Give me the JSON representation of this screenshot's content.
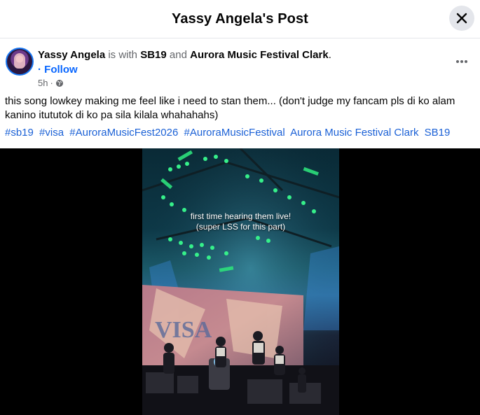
{
  "dialog": {
    "title": "Yassy Angela's Post"
  },
  "post": {
    "author": "Yassy Angela",
    "with_text": "is with",
    "tag1": "SB19",
    "and_text": "and",
    "tag2": "Aurora Music Festival Clark",
    "period": ".",
    "follow": "· Follow",
    "time": "5h",
    "caption": "this song lowkey making me feel like i need to stan them... (don't judge my fancam pls di ko alam kanino itututok di ko pa sila kilala whahahahs)",
    "hashtags": [
      "#sb19",
      "#visa",
      "#AuroraMusicFest2026",
      "#AuroraMusicFestival",
      "Aurora Music Festival Clark",
      "SB19"
    ]
  },
  "video": {
    "overlay_line1": "first time hearing them live!",
    "overlay_line2": "(super LSS for this part)",
    "screen_text": "VISA"
  },
  "colors": {
    "link": "#0866ff",
    "hashtag": "#1b61d6",
    "muted": "#65676b"
  }
}
